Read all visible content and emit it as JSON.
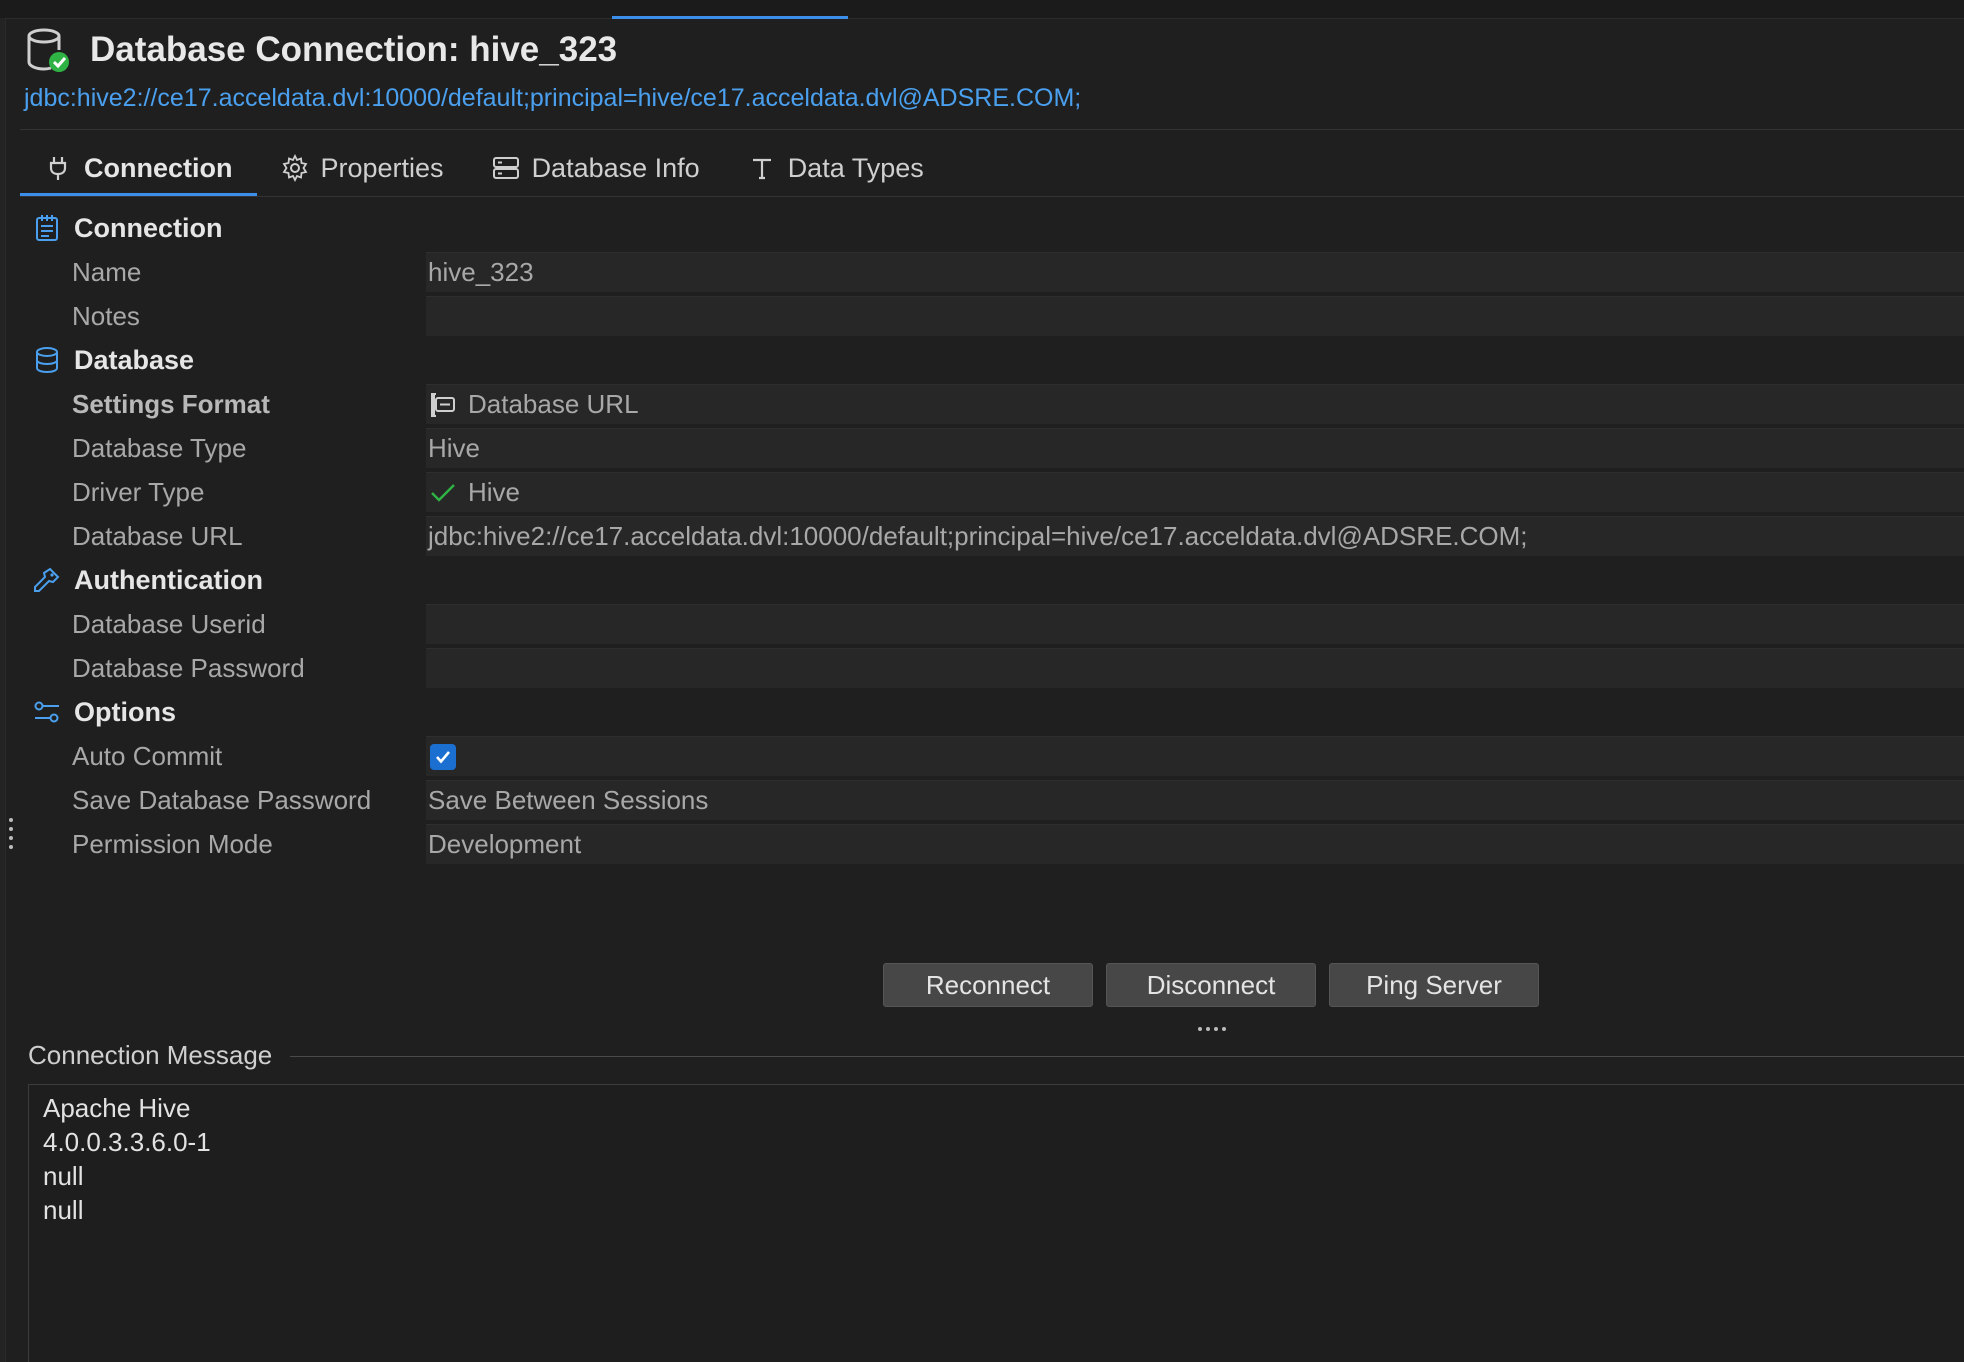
{
  "header": {
    "title": "Database Connection: hive_323",
    "url": "jdbc:hive2://ce17.acceldata.dvl:10000/default;principal=hive/ce17.acceldata.dvl@ADSRE.COM;"
  },
  "tabs": [
    {
      "label": "Connection",
      "icon": "plug-icon",
      "active": true
    },
    {
      "label": "Properties",
      "icon": "gear-icon",
      "active": false
    },
    {
      "label": "Database Info",
      "icon": "server-icon",
      "active": false
    },
    {
      "label": "Data Types",
      "icon": "text-t-icon",
      "active": false
    }
  ],
  "sections": {
    "connection": {
      "title": "Connection",
      "name_label": "Name",
      "name_value": "hive_323",
      "notes_label": "Notes",
      "notes_value": ""
    },
    "database": {
      "title": "Database",
      "settings_format_label": "Settings Format",
      "settings_format_value": "Database URL",
      "database_type_label": "Database Type",
      "database_type_value": "Hive",
      "driver_type_label": "Driver Type",
      "driver_type_value": "Hive",
      "database_url_label": "Database URL",
      "database_url_value": "jdbc:hive2://ce17.acceldata.dvl:10000/default;principal=hive/ce17.acceldata.dvl@ADSRE.COM;"
    },
    "authentication": {
      "title": "Authentication",
      "userid_label": "Database Userid",
      "userid_value": "",
      "password_label": "Database Password",
      "password_value": ""
    },
    "options": {
      "title": "Options",
      "auto_commit_label": "Auto Commit",
      "auto_commit_checked": true,
      "save_password_label": "Save Database Password",
      "save_password_value": "Save Between Sessions",
      "permission_mode_label": "Permission Mode",
      "permission_mode_value": "Development"
    }
  },
  "buttons": {
    "reconnect": "Reconnect",
    "disconnect": "Disconnect",
    "ping": "Ping Server"
  },
  "message": {
    "title": "Connection Message",
    "lines": [
      "Apache Hive",
      "4.0.0.3.3.6.0-1",
      "null",
      "null"
    ]
  },
  "colors": {
    "accent": "#3b8eea",
    "link": "#4aa0ee",
    "success": "#2fb344",
    "checkbox": "#1a6fd0"
  }
}
